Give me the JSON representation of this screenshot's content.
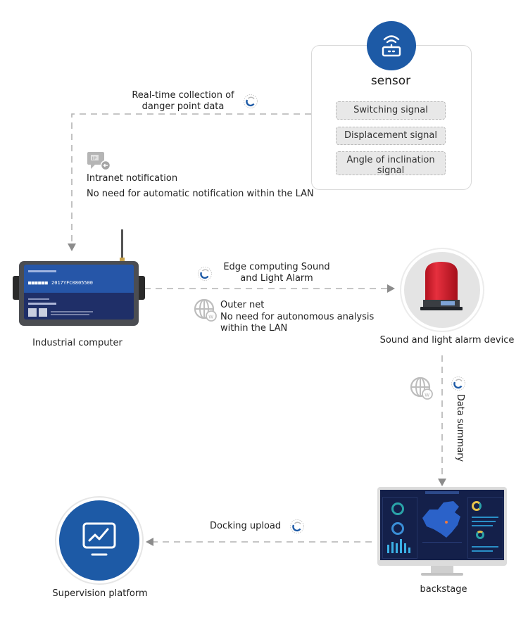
{
  "diagram": {
    "sensor": {
      "title": "sensor",
      "icon": "router-wifi-icon",
      "signals": [
        "Switching signal",
        "Displacement signal",
        "Angle of inclination signal"
      ],
      "signal_lines": [
        [
          "Switching signal"
        ],
        [
          "Displacement signal"
        ],
        [
          "Angle of inclination",
          "signal"
        ]
      ]
    },
    "flows": {
      "collection": {
        "line1": "Real-time collection of",
        "line2": "danger point data",
        "icon": "sync-cycle-icon"
      },
      "intranet": {
        "title": "Intranet notification",
        "desc": "No need for automatic notification within the LAN",
        "icon": "ip-notification-icon"
      },
      "edge": {
        "line1": "Edge computing Sound",
        "line2": "and Light Alarm",
        "icon": "sync-cycle-icon"
      },
      "outer_net": {
        "title": "Outer net",
        "desc_line1": "No need for autonomous analysis",
        "desc_line2": "within the LAN",
        "icon": "globe-web-icon"
      },
      "data_summary": {
        "label": "Data summary",
        "icons": [
          "globe-web-icon",
          "sync-cycle-icon"
        ]
      },
      "docking": {
        "label": "Docking upload",
        "icon": "sync-cycle-icon"
      }
    },
    "nodes": {
      "industrial_computer": {
        "label": "Industrial computer",
        "panel_code": "2017YFC0805500"
      },
      "alarm_device": {
        "label": "Sound and light alarm device"
      },
      "backstage": {
        "label": "backstage"
      },
      "supervision": {
        "label": "Supervision platform",
        "icon": "monitor-chart-icon"
      }
    },
    "colors": {
      "brand_blue": "#1d5aa6",
      "dashed_line": "#b3b3b3",
      "arrow": "#8c8c8c",
      "alarm_red": "#d81e2c",
      "signal_bg": "#e8e8e8",
      "dashboard_bg": "#14204a"
    }
  }
}
